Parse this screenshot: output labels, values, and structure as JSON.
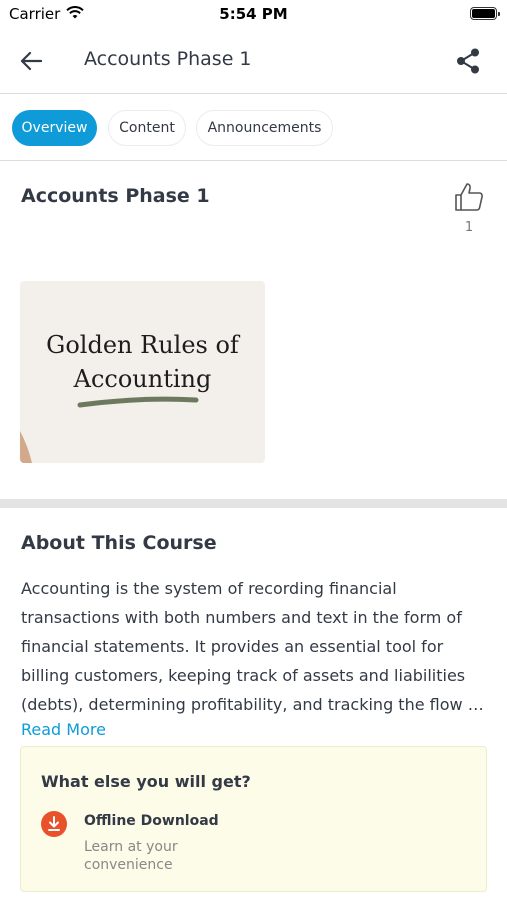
{
  "status_bar": {
    "carrier": "Carrier",
    "time": "5:54 PM"
  },
  "nav": {
    "title": "Accounts Phase 1"
  },
  "tabs": [
    {
      "label": "Overview",
      "active": true
    },
    {
      "label": "Content",
      "active": false
    },
    {
      "label": "Announcements",
      "active": false
    }
  ],
  "course": {
    "title": "Accounts Phase 1",
    "likes": "1",
    "thumbnail": {
      "line1": "Golden Rules of",
      "line2": "Accounting"
    }
  },
  "about": {
    "heading": "About This Course",
    "text": "Accounting is the system of recording financial transactions with both numbers and text in the form of financial statements. It provides an essential tool for billing customers, keeping track of assets and liabilities (debts), determining profitability, and tracking the flow …",
    "read_more": "Read More"
  },
  "extras": {
    "heading": "What else you will get?",
    "items": [
      {
        "title": "Offline Download",
        "subtitle": "Learn at your convenience",
        "icon": "download-icon"
      }
    ]
  },
  "colors": {
    "accent": "#0e9bd8",
    "download_icon_bg": "#e8512a",
    "extras_bg": "#fcfce8"
  }
}
